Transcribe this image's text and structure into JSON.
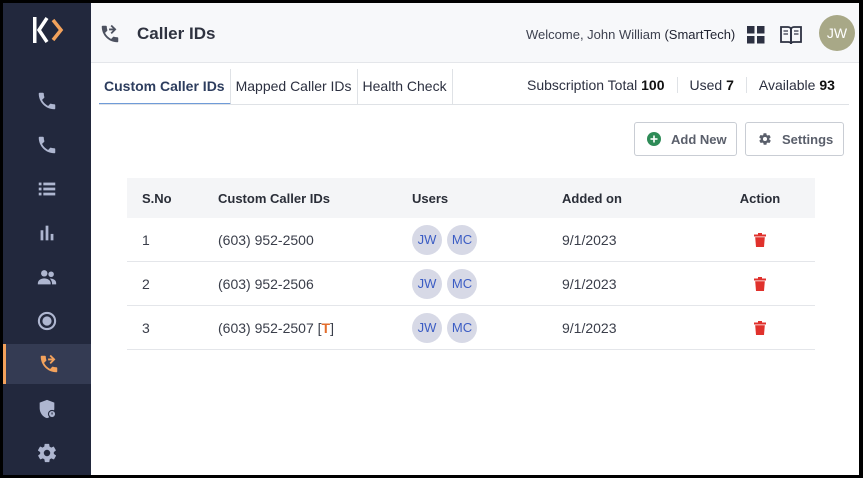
{
  "header": {
    "title": "Caller IDs",
    "welcome_prefix": "Welcome, John William ",
    "welcome_org": "(SmartTech)",
    "avatar": "JW"
  },
  "tabs": [
    {
      "label": "Custom Caller IDs",
      "active": true
    },
    {
      "label": "Mapped Caller IDs",
      "active": false
    },
    {
      "label": "Health Check",
      "active": false
    }
  ],
  "subscription": {
    "total_label": "Subscription Total",
    "total": "100",
    "used_label": "Used",
    "used": "7",
    "available_label": "Available",
    "available": "93"
  },
  "actions": {
    "add_label": "Add New",
    "settings_label": "Settings"
  },
  "table": {
    "headers": [
      "S.No",
      "Custom Caller IDs",
      "Users",
      "Added on",
      "Action"
    ],
    "rows": [
      {
        "sno": "1",
        "number": "(603) 952-2500",
        "tag": "",
        "users": [
          "JW",
          "MC"
        ],
        "added": "9/1/2023"
      },
      {
        "sno": "2",
        "number": "(603) 952-2506",
        "tag": "",
        "users": [
          "JW",
          "MC"
        ],
        "added": "9/1/2023"
      },
      {
        "sno": "3",
        "number": "(603) 952-2507",
        "tag": "T",
        "users": [
          "JW",
          "MC"
        ],
        "added": "9/1/2023"
      }
    ]
  },
  "colors": {
    "sidebar": "#22283d",
    "accent": "#f3a25c",
    "add_icon": "#2e8b57",
    "delete": "#e0312c",
    "chip_text": "#3b5cc4"
  }
}
